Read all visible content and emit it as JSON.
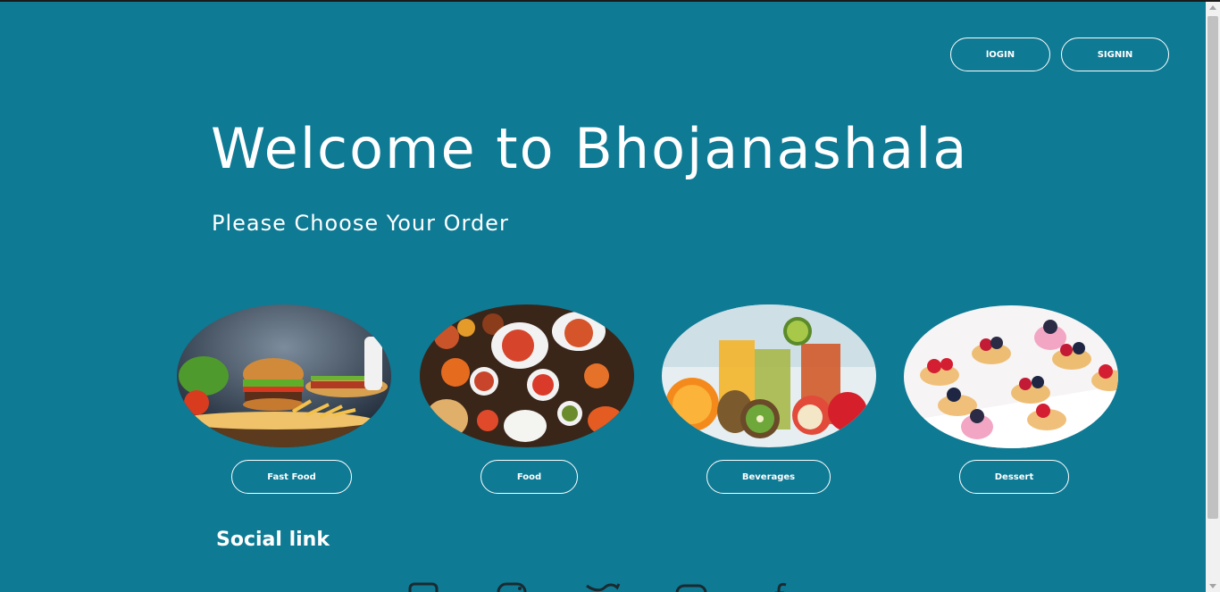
{
  "header": {
    "login_label": "lOGIN",
    "signin_label": "SIGNIN"
  },
  "hero": {
    "title": "Welcome to Bhojanashala",
    "subtitle": "Please Choose Your Order"
  },
  "categories": [
    {
      "label": "Fast Food",
      "image": "fast-food-photo"
    },
    {
      "label": "Food",
      "image": "indian-food-photo"
    },
    {
      "label": "Beverages",
      "image": "juice-drinks-photo"
    },
    {
      "label": "Dessert",
      "image": "berry-tarts-photo"
    }
  ],
  "social": {
    "title": "Social link",
    "icons": [
      "linkedin-icon",
      "instagram-icon",
      "twitter-icon",
      "youtube-icon",
      "facebook-icon"
    ]
  },
  "colors": {
    "background": "#0e7a94",
    "text": "#ffffff"
  }
}
